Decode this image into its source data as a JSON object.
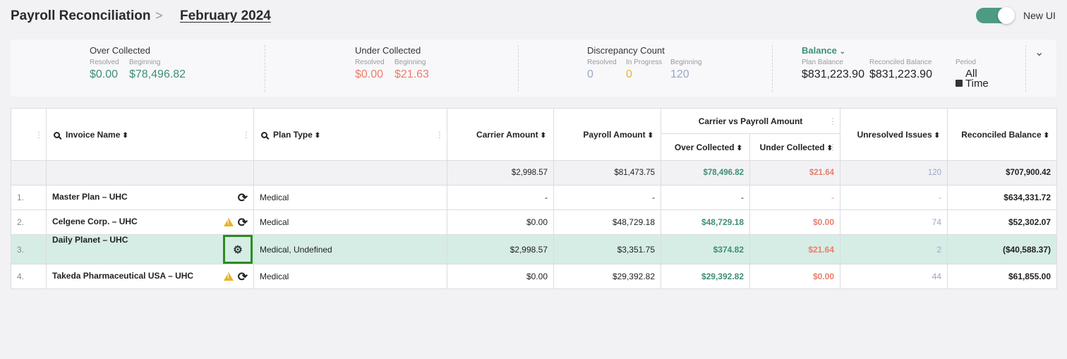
{
  "header": {
    "title": "Payroll Reconciliation",
    "chevron": ">",
    "period": "February 2024",
    "toggle_label": "New UI",
    "toggle_on": true
  },
  "summary": {
    "over_collected": {
      "title": "Over Collected",
      "resolved_label": "Resolved",
      "resolved": "$0.00",
      "beginning_label": "Beginning",
      "beginning": "$78,496.82"
    },
    "under_collected": {
      "title": "Under Collected",
      "resolved_label": "Resolved",
      "resolved": "$0.00",
      "beginning_label": "Beginning",
      "beginning": "$21.63"
    },
    "discrepancy": {
      "title": "Discrepancy Count",
      "resolved_label": "Resolved",
      "resolved": "0",
      "in_progress_label": "In Progress",
      "in_progress": "0",
      "beginning_label": "Beginning",
      "beginning": "120"
    },
    "balance": {
      "title": "Balance",
      "plan_label": "Plan Balance",
      "plan": "$831,223.90",
      "reconciled_label": "Reconciled Balance",
      "reconciled": "$831,223.90",
      "period_label": "Period",
      "period_line1": "All",
      "period_line2": "Time"
    }
  },
  "table": {
    "headers": {
      "invoice_name": "Invoice Name",
      "plan_type": "Plan Type",
      "carrier_amount": "Carrier Amount",
      "payroll_amount": "Payroll Amount",
      "group": "Carrier vs Payroll Amount",
      "over_collected": "Over Collected",
      "under_collected": "Under Collected",
      "unresolved": "Unresolved Issues",
      "reconciled": "Reconciled Balance"
    },
    "totals": {
      "carrier": "$2,998.57",
      "payroll": "$81,473.75",
      "over": "$78,496.82",
      "under": "$21.64",
      "unresolved": "120",
      "reconciled": "$707,900.42"
    },
    "rows": [
      {
        "num": "1.",
        "name": "Master Plan – UHC",
        "plan": "Medical",
        "carrier": "-",
        "payroll": "-",
        "over": "-",
        "under": "-",
        "unresolved": "-",
        "reconciled": "$634,331.72"
      },
      {
        "num": "2.",
        "name": "Celgene Corp. – UHC",
        "plan": "Medical",
        "carrier": "$0.00",
        "payroll": "$48,729.18",
        "over": "$48,729.18",
        "under": "$0.00",
        "unresolved": "74",
        "reconciled": "$52,302.07"
      },
      {
        "num": "3.",
        "name": "Daily Planet – UHC",
        "plan": "Medical, Undefined",
        "carrier": "$2,998.57",
        "payroll": "$3,351.75",
        "over": "$374.82",
        "under": "$21.64",
        "unresolved": "2",
        "reconciled": "($40,588.37)"
      },
      {
        "num": "4.",
        "name": "Takeda Pharmaceutical USA – UHC",
        "plan": "Medical",
        "carrier": "$0.00",
        "payroll": "$29,392.82",
        "over": "$29,392.82",
        "under": "$0.00",
        "unresolved": "44",
        "reconciled": "$61,855.00"
      }
    ]
  },
  "colors": {
    "accent_green": "#3e8f72",
    "red": "#ec7d6a",
    "highlight_row": "#d6ede5",
    "selection_box": "#2e8b20"
  }
}
